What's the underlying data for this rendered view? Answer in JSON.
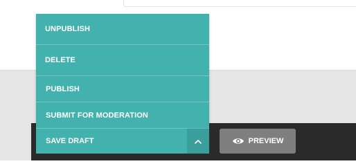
{
  "menu": {
    "items": [
      {
        "label": "UNPUBLISH"
      },
      {
        "label": "DELETE"
      },
      {
        "label": "PUBLISH"
      },
      {
        "label": "SUBMIT FOR MODERATION"
      }
    ]
  },
  "footer": {
    "save_draft_label": "SAVE DRAFT",
    "preview_label": "PREVIEW"
  },
  "icons": {
    "toggle": "chevron-up-icon",
    "preview": "eye-icon"
  },
  "colors": {
    "accent": "#43b1ad",
    "footer_bg": "#2b2b2b",
    "preview_bg": "#7f7f7f"
  }
}
